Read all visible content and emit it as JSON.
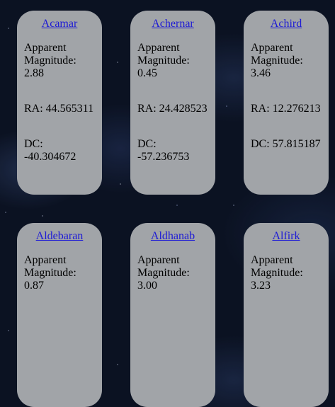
{
  "stars": [
    {
      "name": "Acamar",
      "magnitude_label": "Apparent Magnitude:",
      "magnitude": "2.88",
      "ra_label": "RA:",
      "ra": "44.565311",
      "dc_label": "DC:",
      "dc": "-40.304672"
    },
    {
      "name": "Achernar",
      "magnitude_label": "Apparent Magnitude:",
      "magnitude": "0.45",
      "ra_label": "RA:",
      "ra": "24.428523",
      "dc_label": "DC:",
      "dc": "-57.236753"
    },
    {
      "name": "Achird",
      "magnitude_label": "Apparent Magnitude:",
      "magnitude": "3.46",
      "ra_label": "RA:",
      "ra": "12.276213",
      "dc_label": "DC:",
      "dc": "57.815187"
    },
    {
      "name": "Aldebaran",
      "magnitude_label": "Apparent Magnitude:",
      "magnitude": "0.87"
    },
    {
      "name": "Aldhanab",
      "magnitude_label": "Apparent Magnitude:",
      "magnitude": "3.00"
    },
    {
      "name": "Alfirk",
      "magnitude_label": "Apparent Magnitude:",
      "magnitude": "3.23"
    }
  ],
  "colors": {
    "card_background": "#a1a4a8",
    "link": "#1c19d6",
    "page_background": "#0b1222"
  }
}
